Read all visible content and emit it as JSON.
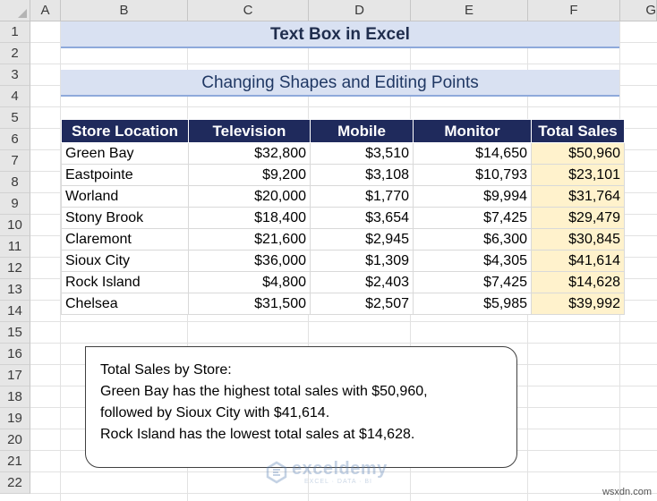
{
  "columns": [
    "A",
    "B",
    "C",
    "D",
    "E",
    "F",
    "G"
  ],
  "rows": [
    "1",
    "2",
    "3",
    "4",
    "5",
    "6",
    "7",
    "8",
    "9",
    "10",
    "11",
    "12",
    "13",
    "14",
    "15",
    "16",
    "17",
    "18",
    "19",
    "20",
    "21",
    "22"
  ],
  "title": "Text Box in Excel",
  "subtitle": "Changing Shapes and Editing Points",
  "table": {
    "headers": [
      "Store Location",
      "Television",
      "Mobile",
      "Monitor",
      "Total Sales"
    ],
    "rows": [
      [
        "Green Bay",
        "$32,800",
        "$3,510",
        "$14,650",
        "$50,960"
      ],
      [
        "Eastpointe",
        "$9,200",
        "$3,108",
        "$10,793",
        "$23,101"
      ],
      [
        "Worland",
        "$20,000",
        "$1,770",
        "$9,994",
        "$31,764"
      ],
      [
        "Stony Brook",
        "$18,400",
        "$3,654",
        "$7,425",
        "$29,479"
      ],
      [
        "Claremont",
        "$21,600",
        "$2,945",
        "$6,300",
        "$30,845"
      ],
      [
        "Sioux City",
        "$36,000",
        "$1,309",
        "$4,305",
        "$41,614"
      ],
      [
        "Rock Island",
        "$4,800",
        "$2,403",
        "$7,425",
        "$14,628"
      ],
      [
        "Chelsea",
        "$31,500",
        "$2,507",
        "$5,985",
        "$39,992"
      ]
    ]
  },
  "textbox": {
    "line1": "Total Sales by Store:",
    "line2": "Green Bay has the highest total sales with $50,960,",
    "line3": "followed by Sioux City with $41,614.",
    "line4": "Rock Island has the lowest total sales at $14,628."
  },
  "watermark": {
    "name": "exceldemy",
    "tagline": "EXCEL · DATA · BI"
  },
  "footer": "wsxdn.com",
  "colors": {
    "header_bg": "#1f2a5c",
    "title_bg": "#d9e1f2",
    "total_bg": "#fff2cc"
  }
}
